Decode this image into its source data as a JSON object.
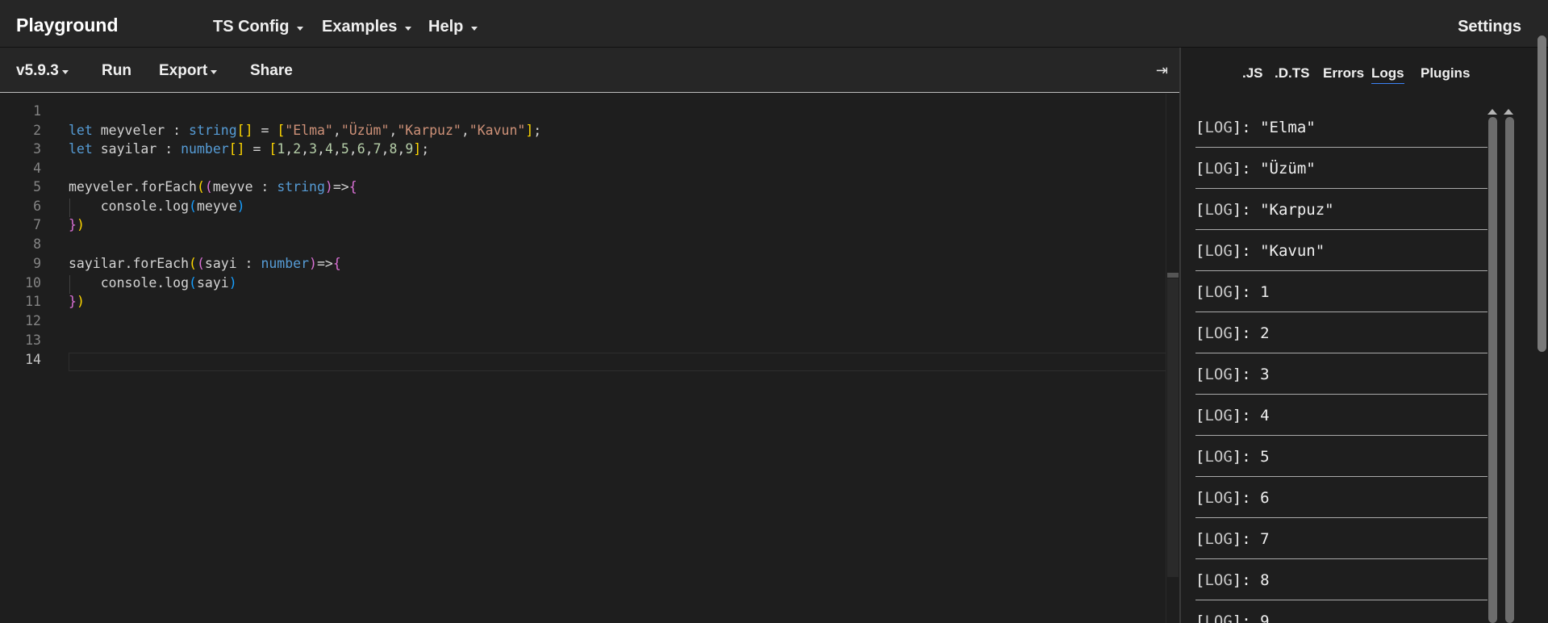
{
  "topnav": {
    "brand": "Playground",
    "menus": [
      "TS Config",
      "Examples",
      "Help"
    ],
    "settings": "Settings"
  },
  "toolbar": {
    "version": "v5.9.3",
    "run": "Run",
    "export": "Export",
    "share": "Share",
    "collapse_icon": "⇥"
  },
  "editor": {
    "line_numbers": [
      "1",
      "2",
      "3",
      "4",
      "5",
      "6",
      "7",
      "8",
      "9",
      "10",
      "11",
      "12",
      "13",
      "14"
    ],
    "active_line": 14
  },
  "sidebar": {
    "tabs": [
      ".JS",
      ".D.TS",
      "Errors",
      "Logs",
      "Plugins"
    ],
    "active_tab": "Logs",
    "log_tag": "LOG",
    "logs": [
      "\"Elma\"",
      "\"Üzüm\"",
      "\"Karpuz\"",
      "\"Kavun\"",
      "1",
      "2",
      "3",
      "4",
      "5",
      "6",
      "7",
      "8",
      "9"
    ]
  },
  "colors": {
    "background": "#1e1e1e",
    "nav": "#262626",
    "keyword": "#569cd6",
    "string": "#ce9178",
    "number": "#b5cea8",
    "active_tab_underline": "#3b82f6"
  }
}
